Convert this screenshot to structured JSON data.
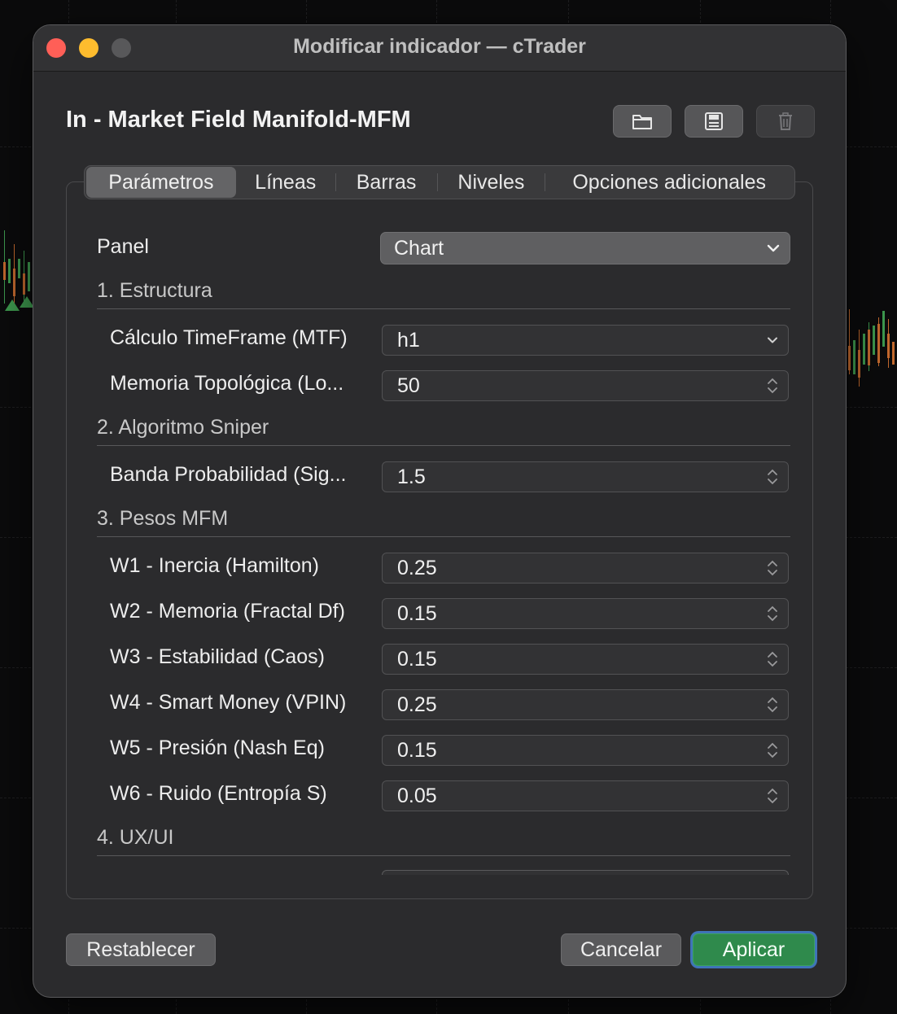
{
  "window": {
    "title": "Modificar indicador — cTrader"
  },
  "indicator": {
    "title": "In - Market Field Manifold-MFM"
  },
  "toolbar": {
    "open_icon": "folder-icon",
    "save_icon": "floppy-disk-icon",
    "delete_icon": "trash-icon"
  },
  "tabs": [
    {
      "label": "Parámetros",
      "active": true
    },
    {
      "label": "Líneas",
      "active": false
    },
    {
      "label": "Barras",
      "active": false
    },
    {
      "label": "Niveles",
      "active": false
    },
    {
      "label": "Opciones adicionales",
      "active": false
    }
  ],
  "params": {
    "panel_label": "Panel",
    "panel_value": "Chart",
    "sections": [
      {
        "title": "1. Estructura"
      },
      {
        "title": "2. Algoritmo Sniper"
      },
      {
        "title": "3. Pesos MFM"
      },
      {
        "title": "4. UX/UI"
      }
    ],
    "fields": [
      {
        "label": "Cálculo TimeFrame (MTF)",
        "value": "h1",
        "kind": "select"
      },
      {
        "label": "Memoria Topológica (Lo...",
        "value": "50",
        "kind": "number"
      },
      {
        "label": "Banda Probabilidad (Sig...",
        "value": "1.5",
        "kind": "number"
      },
      {
        "label": "W1 - Inercia (Hamilton)",
        "value": "0.25",
        "kind": "number"
      },
      {
        "label": "W2 - Memoria (Fractal Df)",
        "value": "0.15",
        "kind": "number"
      },
      {
        "label": "W3 - Estabilidad (Caos)",
        "value": "0.15",
        "kind": "number"
      },
      {
        "label": "W4 - Smart Money (VPIN)",
        "value": "0.25",
        "kind": "number"
      },
      {
        "label": "W5 - Presión (Nash Eq)",
        "value": "0.15",
        "kind": "number"
      },
      {
        "label": "W6 - Ruido (Entropía S)",
        "value": "0.05",
        "kind": "number"
      }
    ]
  },
  "buttons": {
    "reset": "Restablecer",
    "cancel": "Cancelar",
    "apply": "Aplicar"
  },
  "colors": {
    "primary": "#2f8a4c",
    "focus_ring": "#3f74b8",
    "close": "#ff5f57",
    "minimize": "#febc2e"
  }
}
